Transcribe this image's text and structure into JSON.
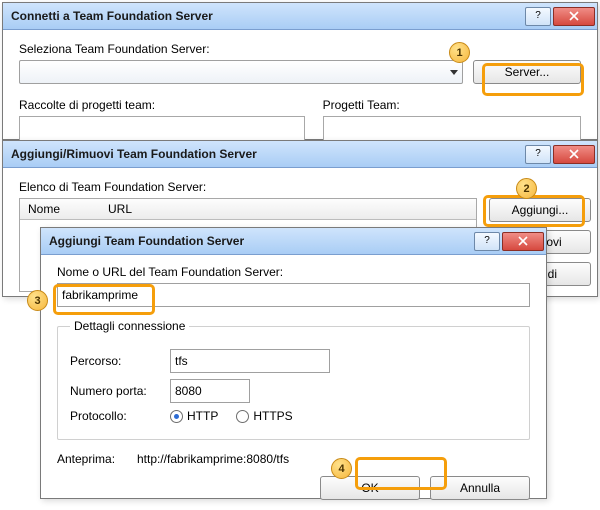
{
  "dlg1": {
    "title": "Connetti a Team Foundation Server",
    "select_label": "Seleziona Team Foundation Server:",
    "server_btn": "Server...",
    "collections_label": "Raccolte di progetti team:",
    "projects_label": "Progetti Team:"
  },
  "dlg2": {
    "title": "Aggiungi/Rimuovi Team Foundation Server",
    "list_label": "Elenco di Team Foundation Server:",
    "col_name": "Nome",
    "col_url": "URL",
    "add_btn": "Aggiungi...",
    "remove_btn": "Rimuovi",
    "close_btn": "Chiudi"
  },
  "dlg3": {
    "title": "Aggiungi Team Foundation Server",
    "name_label": "Nome o URL del Team Foundation Server:",
    "name_value": "fabrikamprime",
    "group_legend": "Dettagli connessione",
    "path_label": "Percorso:",
    "path_value": "tfs",
    "port_label": "Numero porta:",
    "port_value": "8080",
    "protocol_label": "Protocollo:",
    "http_label": "HTTP",
    "https_label": "HTTPS",
    "preview_label": "Anteprima:",
    "preview_value": "http://fabrikamprime:8080/tfs",
    "ok_btn": "OK",
    "cancel_btn": "Annulla"
  },
  "callouts": {
    "c1": "1",
    "c2": "2",
    "c3": "3",
    "c4": "4"
  }
}
